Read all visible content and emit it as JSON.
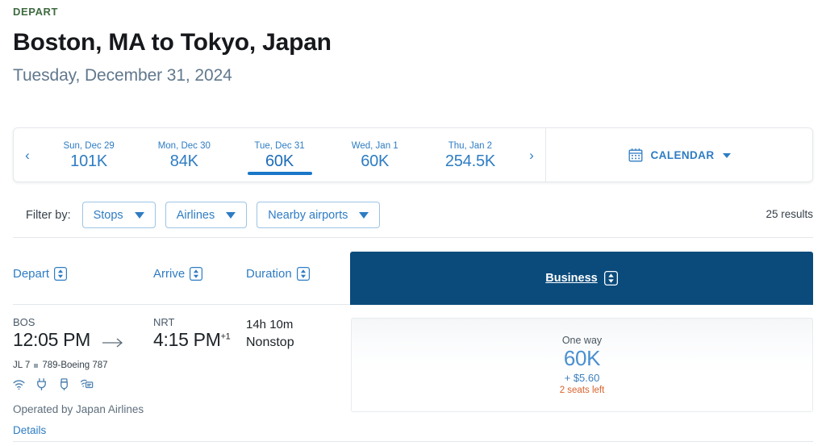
{
  "header": {
    "eyebrow": "DEPART",
    "route_title": "Boston, MA to Tokyo, Japan",
    "date_subtitle": "Tuesday, December 31, 2024"
  },
  "date_strip": {
    "prev_label": "‹",
    "next_label": "›",
    "dates": [
      {
        "label": "Sun, Dec 29",
        "price": "101K",
        "selected": false
      },
      {
        "label": "Mon, Dec 30",
        "price": "84K",
        "selected": false
      },
      {
        "label": "Tue, Dec 31",
        "price": "60K",
        "selected": true
      },
      {
        "label": "Wed, Jan 1",
        "price": "60K",
        "selected": false
      },
      {
        "label": "Thu, Jan 2",
        "price": "254.5K",
        "selected": false
      }
    ],
    "calendar_button": {
      "label": "CALENDAR",
      "icon": "calendar-icon",
      "caret": "chevron-down-icon"
    }
  },
  "filters": {
    "label": "Filter by:",
    "buttons": [
      {
        "label": "Stops"
      },
      {
        "label": "Airlines"
      },
      {
        "label": "Nearby airports"
      }
    ],
    "results_count": "25 results"
  },
  "sort_headers": [
    {
      "label": "Depart"
    },
    {
      "label": "Arrive"
    },
    {
      "label": "Duration"
    }
  ],
  "cabin": {
    "label": "Business"
  },
  "flight": {
    "depart_code": "BOS",
    "depart_time": "12:05 PM",
    "arrive_code": "NRT",
    "arrive_time": "4:15 PM",
    "arrive_day_offset": "+1",
    "duration": "14h 10m",
    "stops": "Nonstop",
    "flight_number": "JL 7",
    "aircraft": "789-Boeing 787",
    "amenities": [
      "wifi-icon",
      "power-outlet-icon",
      "usb-port-icon",
      "entertainment-icon"
    ],
    "operated_by": "Operated by Japan Airlines",
    "details_label": "Details"
  },
  "price": {
    "trip_type": "One way",
    "miles": "60K",
    "taxes": "+ $5.60",
    "seats_left": "2 seats left"
  },
  "colors": {
    "accent_blue": "#2e7cc3",
    "cabin_navy": "#0a4b7c",
    "eyebrow_green": "#3f6b40",
    "seats_orange": "#d9622b",
    "underline_blue": "#1a76c8"
  }
}
